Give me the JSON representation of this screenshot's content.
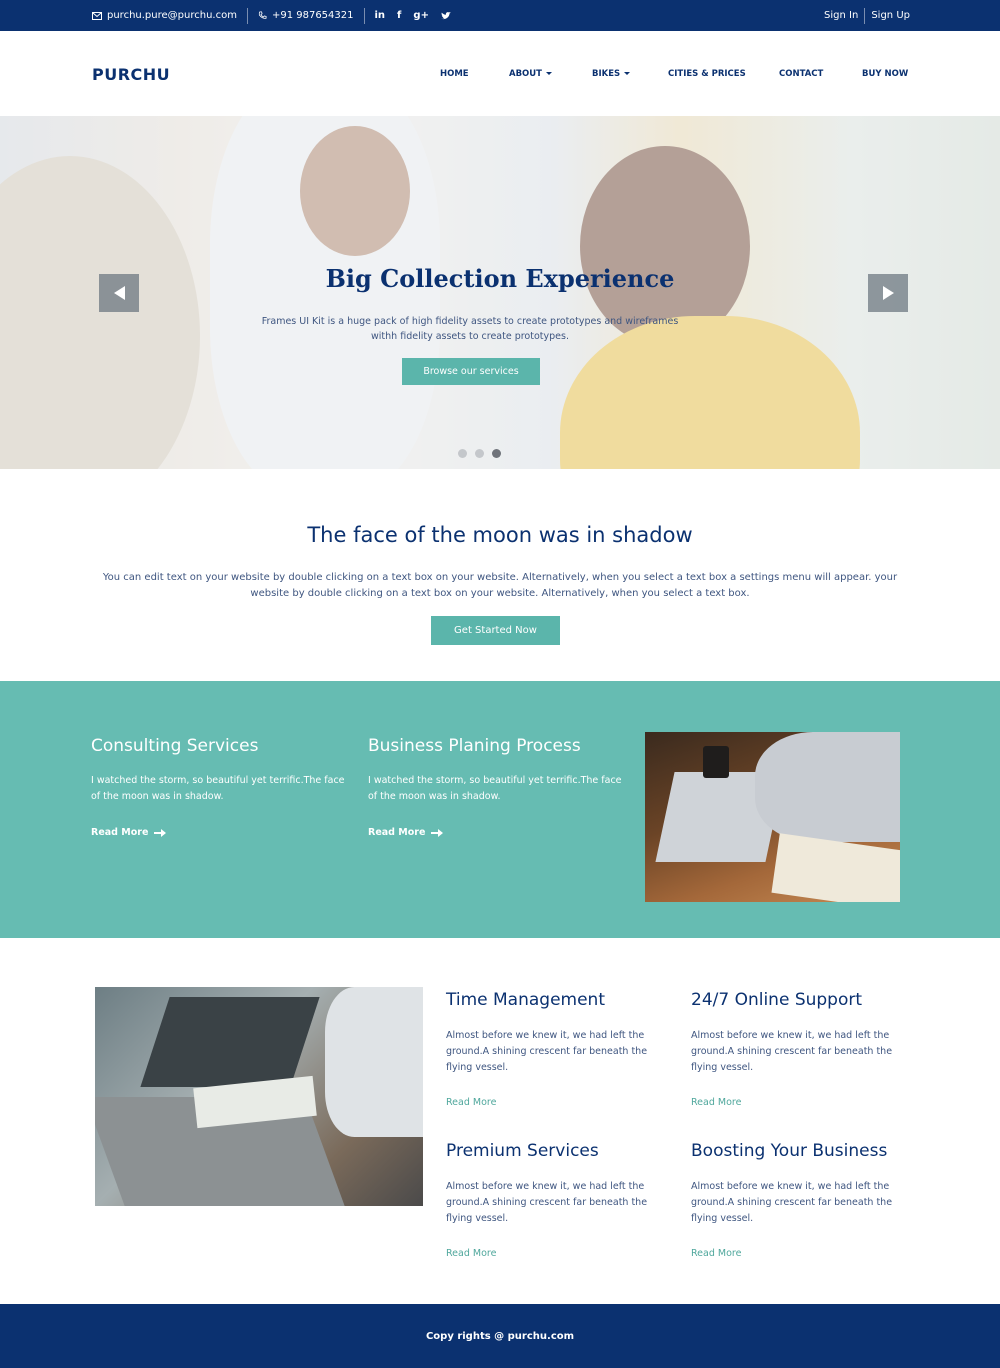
{
  "topbar": {
    "email": "purchu.pure@purchu.com",
    "phone": "+91 987654321",
    "social": [
      "in",
      "f",
      "g+",
      "t"
    ],
    "sign_in": "Sign In",
    "sign_up": "Sign Up"
  },
  "nav": {
    "logo": "PURCHU",
    "items": [
      "HOME",
      "ABOUT",
      "BIKES",
      "CITIES & PRICES",
      "CONTACT",
      "BUY NOW"
    ]
  },
  "hero": {
    "title": "Big Collection Experience",
    "text": "Frames UI Kit is a huge pack of high fidelity assets to create prototypes and wireframes withh fidelity assets to create prototypes.",
    "button": "Browse our services",
    "slides": 3,
    "active_slide": 3
  },
  "intro": {
    "title": "The face of the moon was in shadow",
    "text": "You can edit text on your website by double clicking on a text box on your website. Alternatively, when you select a text box a settings menu will appear. your website by double clicking on a text box on your website. Alternatively, when you select a text box.",
    "button": "Get Started Now"
  },
  "services": [
    {
      "title": "Consulting Services",
      "text": "I watched the storm, so beautiful yet terrific.The face of the moon was in shadow.",
      "link": "Read More"
    },
    {
      "title": "Business Planing Process",
      "text": "I watched the storm, so beautiful yet terrific.The face of the moon was in shadow.",
      "link": "Read More"
    }
  ],
  "features": [
    {
      "title": "Time Management",
      "text": "Almost before we knew it, we had left the ground.A shining crescent far beneath the flying vessel.",
      "link": "Read More"
    },
    {
      "title": "24/7 Online Support",
      "text": "Almost before we knew it, we had left the ground.A shining crescent far beneath the flying vessel.",
      "link": "Read More"
    },
    {
      "title": "Premium Services",
      "text": "Almost before we knew it, we had left the ground.A shining crescent far beneath the flying vessel.",
      "link": "Read More"
    },
    {
      "title": "Boosting Your Business",
      "text": "Almost before we knew it, we had left the ground.A shining crescent far beneath the flying vessel.",
      "link": "Read More"
    }
  ],
  "footer": {
    "text": "Copy rights @ purchu.com"
  },
  "colors": {
    "navy": "#0b3170",
    "teal": "#66bcb2",
    "button_teal": "#5bb5ab"
  }
}
